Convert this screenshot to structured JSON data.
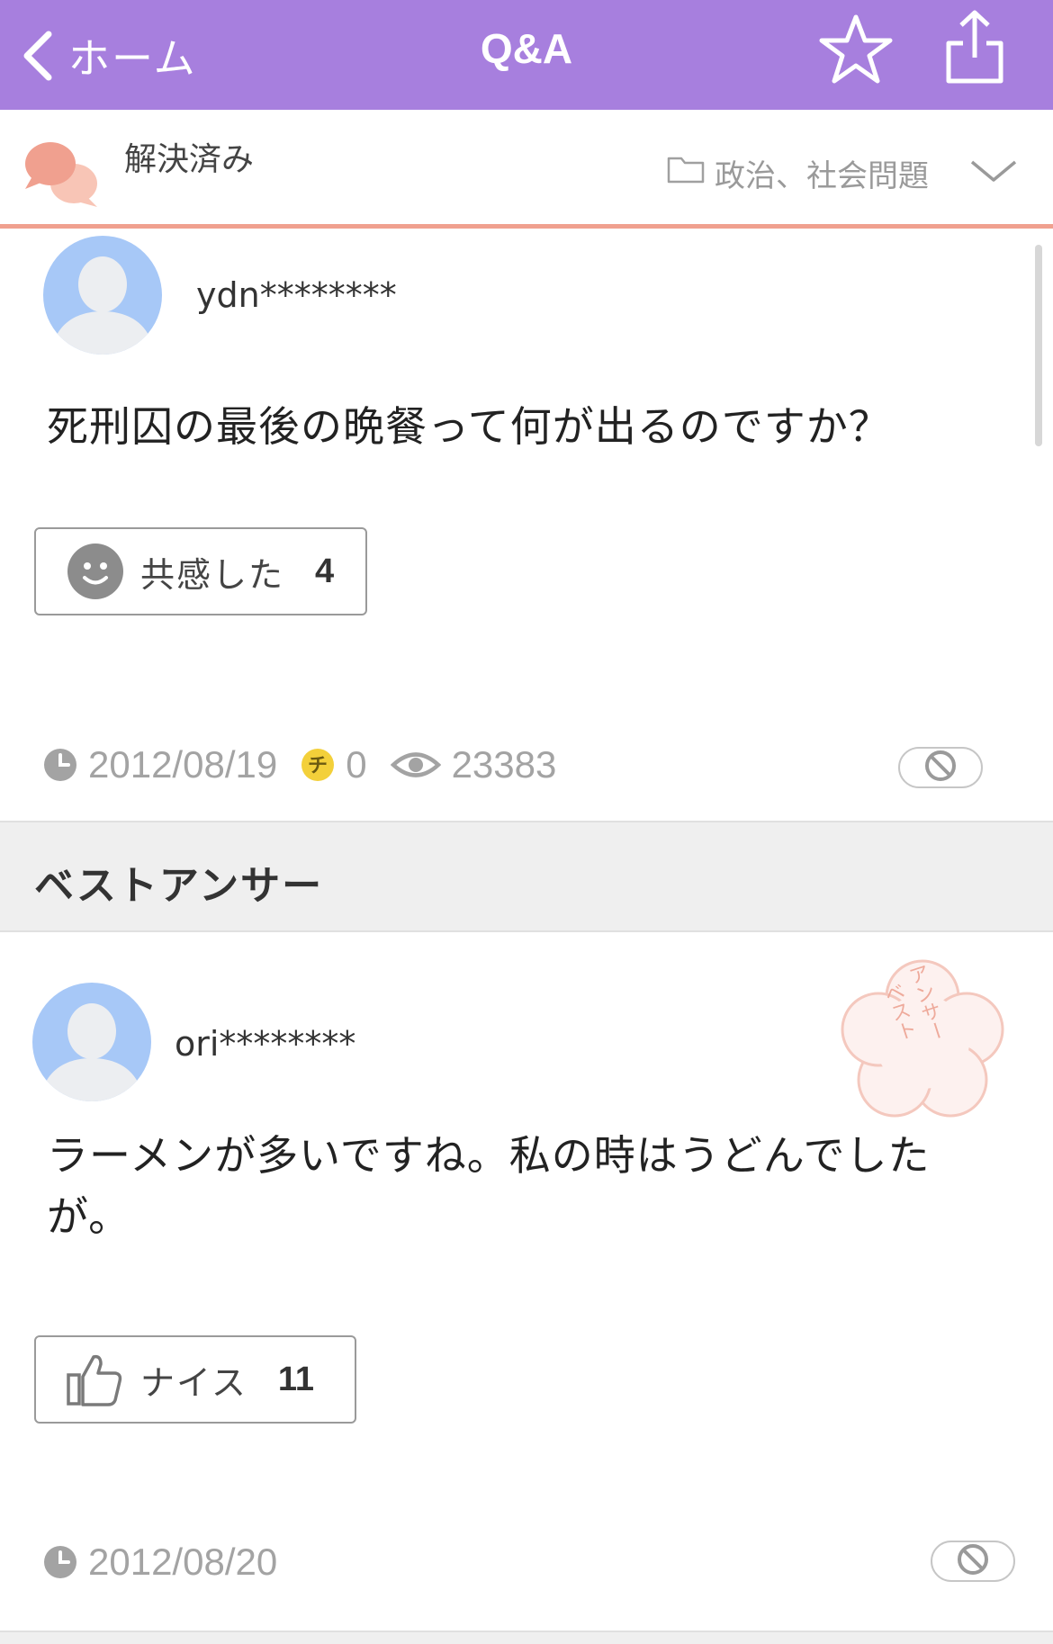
{
  "nav": {
    "back_label": "ホーム",
    "title": "Q&A",
    "bar_color": "#a77fde",
    "icons": [
      "chevron-left-icon",
      "star-outline-icon",
      "share-icon"
    ]
  },
  "status": {
    "label": "解決済み",
    "category": "政治、社会問題",
    "accent_color": "#f0a08f"
  },
  "question": {
    "user": "ydn********",
    "text": "死刑囚の最後の晩餐って何が出るのですか？",
    "empathy": {
      "label": "共感した",
      "count": "4"
    },
    "date": "2012/08/19",
    "coins": "0",
    "views": "23383"
  },
  "best_answer": {
    "section_title": "ベストアンサー",
    "stamp_text": "ベストアンサー",
    "user": "ori********",
    "text": "ラーメンが多いですね。私の時はうどんでしたが。",
    "nice": {
      "label": "ナイス",
      "count": "11"
    },
    "date": "2012/08/20"
  }
}
